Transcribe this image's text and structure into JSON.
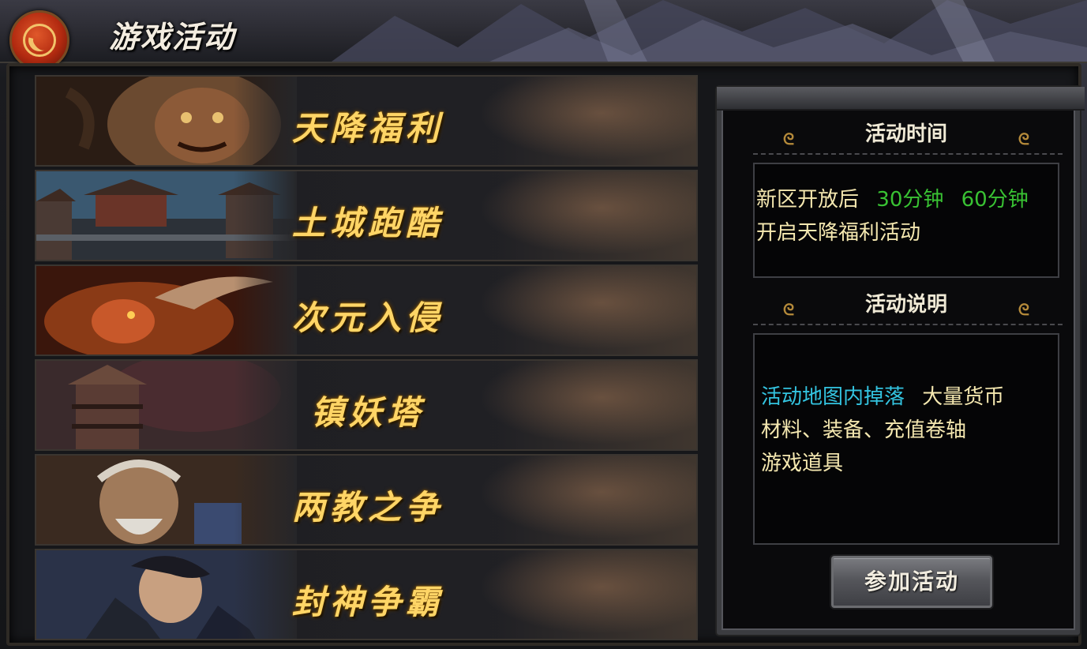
{
  "header": {
    "title": "游戏活动",
    "emblem_icon": "yin-yang-icon"
  },
  "activities": [
    {
      "label": "天降福利",
      "art": "demon-lion-portrait"
    },
    {
      "label": "土城跑酷",
      "art": "city-gate-scene"
    },
    {
      "label": "次元入侵",
      "art": "horned-beast"
    },
    {
      "label": "镇妖塔",
      "art": "pagoda-tower"
    },
    {
      "label": "两教之争",
      "art": "elder-sage-portrait"
    },
    {
      "label": "封神争霸",
      "art": "armored-warrior-portrait"
    }
  ],
  "info": {
    "time_heading": "活动时间",
    "time_prefix": "新区开放后",
    "time_slot_1": "30分钟",
    "time_slot_2": "60分钟",
    "time_suffix": "开启天降福利活动",
    "desc_heading": "活动说明",
    "desc_highlight": "活动地图内掉落",
    "desc_line1_rest": "大量货币",
    "desc_line2": "材料、装备、充值卷轴",
    "desc_line3": "游戏道具",
    "join_button": "参加活动"
  },
  "colors": {
    "gold_label": "#ffd566",
    "green_time": "#39c233",
    "cyan_highlight": "#33c4e0",
    "yellow_text": "#f5e8b0"
  }
}
